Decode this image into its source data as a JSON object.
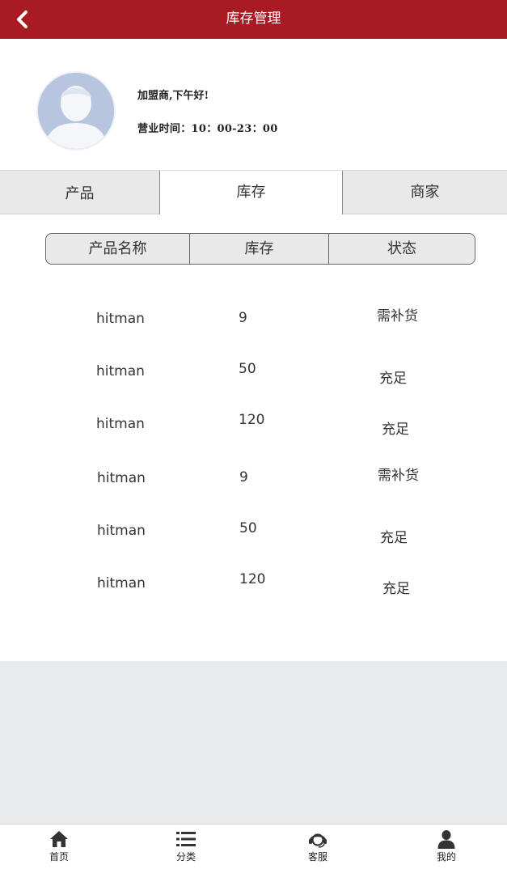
{
  "header": {
    "title": "库存管理"
  },
  "profile": {
    "greeting": "加盟商,下午好!",
    "hours": "营业时间：10：00-23：00"
  },
  "tabs": [
    {
      "label": "产品",
      "active": false
    },
    {
      "label": "库存",
      "active": true
    },
    {
      "label": "商家",
      "active": false
    }
  ],
  "table": {
    "headers": [
      "产品名称",
      "库存",
      "状态"
    ],
    "rows": [
      {
        "name": "hitman",
        "stock": "9",
        "status": "需补货"
      },
      {
        "name": "hitman",
        "stock": "50",
        "status": "充足"
      },
      {
        "name": "hitman",
        "stock": "120",
        "status": "充足"
      },
      {
        "name": "hitman",
        "stock": "9",
        "status": "需补货"
      },
      {
        "name": "hitman",
        "stock": "50",
        "status": "充足"
      },
      {
        "name": "hitman",
        "stock": "120",
        "status": "充足"
      }
    ]
  },
  "nav": [
    {
      "label": "首页",
      "icon": "home-icon"
    },
    {
      "label": "分类",
      "icon": "list-icon"
    },
    {
      "label": "客服",
      "icon": "headset-icon"
    },
    {
      "label": "我的",
      "icon": "user-icon"
    }
  ],
  "colors": {
    "brand": "#a91b24",
    "background": "#e9eaec"
  }
}
